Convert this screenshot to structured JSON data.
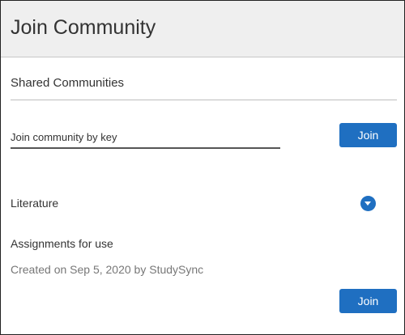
{
  "dialog": {
    "title": "Join Community"
  },
  "shared_communities": {
    "heading": "Shared Communities",
    "key_input": {
      "placeholder": "Join community by key",
      "value": ""
    },
    "join_by_key_label": "Join"
  },
  "community": {
    "name": "Literature",
    "description": "Assignments for use",
    "meta": "Created on Sep 5, 2020 by StudySync",
    "join_label": "Join",
    "toggle_icon": "chevron-down-circle-icon"
  },
  "colors": {
    "accent": "#1f6fc1",
    "header_bg": "#efefef",
    "text": "#333333",
    "muted_text": "#777777"
  }
}
